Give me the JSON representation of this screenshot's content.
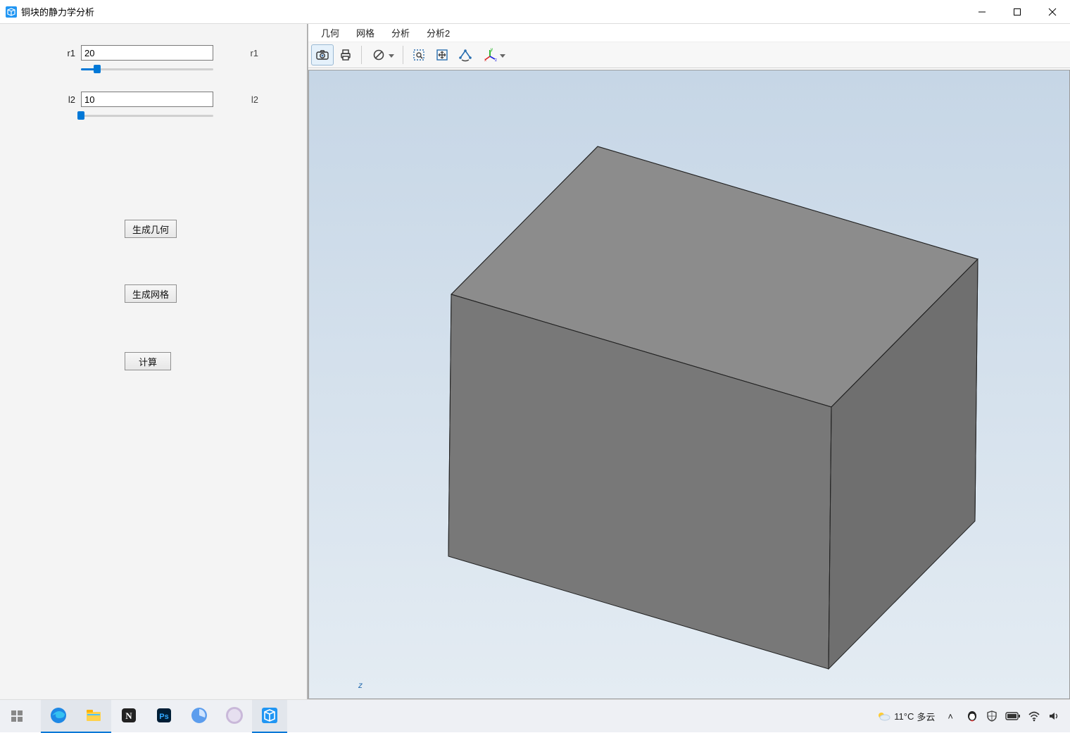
{
  "window": {
    "title": "铜块的静力学分析"
  },
  "params": {
    "r1": {
      "label": "r1",
      "value": "20",
      "tail": "r1",
      "slider_pct": 12
    },
    "l2": {
      "label": "l2",
      "value": "10",
      "tail": "l2",
      "slider_pct": 0
    }
  },
  "buttons": {
    "gen_geom": "生成几何",
    "gen_mesh": "生成网格",
    "compute": "计算"
  },
  "menubar": {
    "geometry": "几何",
    "mesh": "网格",
    "analysis": "分析",
    "analysis2": "分析2"
  },
  "toolbar": {
    "icons": {
      "camera": "camera-icon",
      "print": "print-icon",
      "deny": "no-entry-icon",
      "zoom_window": "zoom-window-icon",
      "zoom_fit": "zoom-fit-icon",
      "rotate": "rotate-3d-icon",
      "axes": "axes-triad-icon"
    }
  },
  "axis_marker": "z",
  "tray": {
    "weather_temp": "11°C",
    "weather_text": "多云",
    "chevron": "^"
  },
  "chart_data": {
    "type": "3d-block",
    "r1": 20,
    "l2": 10,
    "description": "Isometric rendering of a solid rectangular cuboid (copper block) for static mechanical analysis"
  }
}
